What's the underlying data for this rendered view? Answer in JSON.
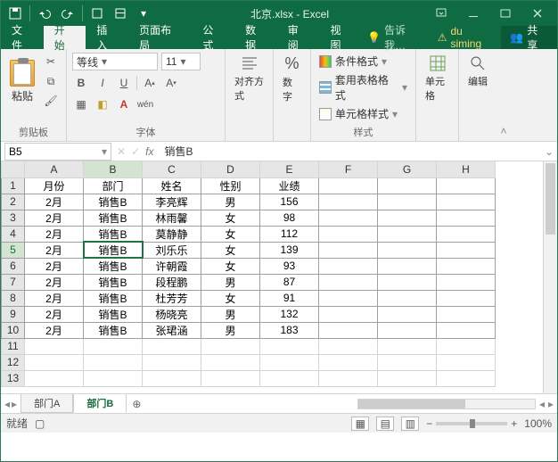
{
  "window": {
    "title": "北京.xlsx - Excel"
  },
  "menu": {
    "tabs": [
      "文件",
      "开始",
      "插入",
      "页面布局",
      "公式",
      "数据",
      "审阅",
      "视图"
    ],
    "active": 1,
    "tellme": "告诉我…",
    "user": "du siming",
    "share": "共享"
  },
  "ribbon": {
    "clipboard": {
      "paste": "粘贴",
      "label": "剪贴板"
    },
    "font": {
      "name": "等线",
      "size": "11",
      "label": "字体",
      "bold": "B",
      "italic": "I",
      "underline": "U"
    },
    "align": {
      "label": "对齐方式"
    },
    "number": {
      "label": "数字",
      "pct": "%"
    },
    "styles": {
      "cf": "条件格式",
      "tf": "套用表格格式",
      "cs": "单元格样式",
      "label": "样式"
    },
    "cells": {
      "label": "单元格"
    },
    "editing": {
      "label": "编辑"
    }
  },
  "namebox": {
    "ref": "B5",
    "formula": "销售B"
  },
  "grid": {
    "cols": [
      "A",
      "B",
      "C",
      "D",
      "E",
      "F",
      "G",
      "H"
    ],
    "rows": 13,
    "headers": [
      "月份",
      "部门",
      "姓名",
      "性别",
      "业绩"
    ],
    "data": [
      [
        "2月",
        "销售B",
        "李亮辉",
        "男",
        "156"
      ],
      [
        "2月",
        "销售B",
        "林雨馨",
        "女",
        "98"
      ],
      [
        "2月",
        "销售B",
        "莫静静",
        "女",
        "112"
      ],
      [
        "2月",
        "销售B",
        "刘乐乐",
        "女",
        "139"
      ],
      [
        "2月",
        "销售B",
        "许朝霞",
        "女",
        "93"
      ],
      [
        "2月",
        "销售B",
        "段程鹏",
        "男",
        "87"
      ],
      [
        "2月",
        "销售B",
        "杜芳芳",
        "女",
        "91"
      ],
      [
        "2月",
        "销售B",
        "杨晓亮",
        "男",
        "132"
      ],
      [
        "2月",
        "销售B",
        "张珺涵",
        "男",
        "183"
      ]
    ],
    "selected": {
      "row": 5,
      "col": "B"
    }
  },
  "sheets": {
    "tabs": [
      "部门A",
      "部门B"
    ],
    "active": 1
  },
  "status": {
    "ready": "就绪",
    "zoom": "100%"
  }
}
